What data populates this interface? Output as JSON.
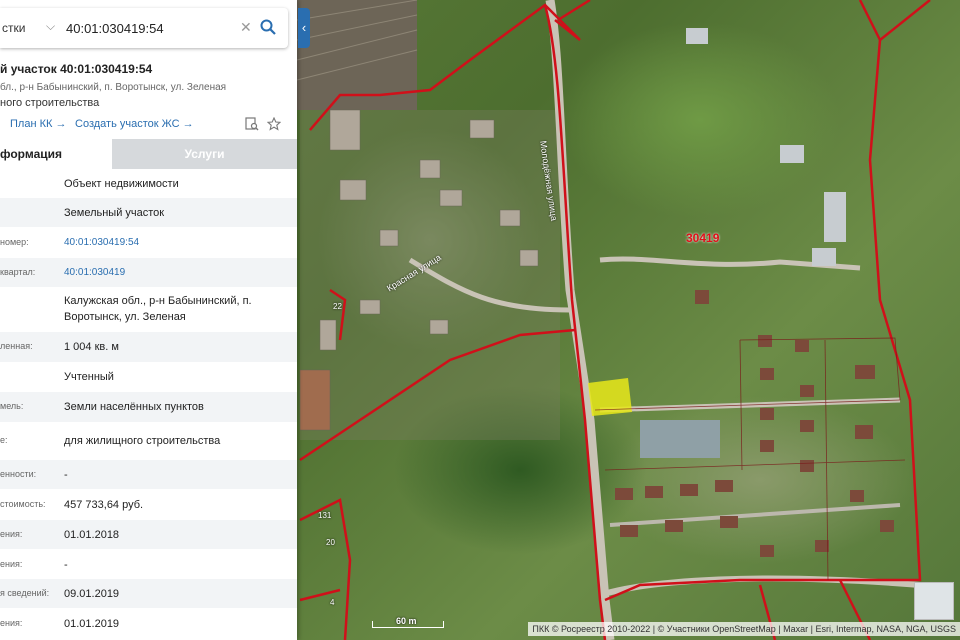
{
  "search": {
    "type_label": "стки",
    "value": "40:01:030419:54"
  },
  "object": {
    "title": "й участок 40:01:030419:54",
    "address_short": "бл., р-н Бабынинский, п. Воротынск, ул. Зеленая",
    "usage_short": "ного строительства"
  },
  "actions": {
    "plan_kk": "План КК →",
    "create_zs": "Создать участок ЖС →"
  },
  "tabs": {
    "info": "формация",
    "services": "Услуги"
  },
  "properties": [
    {
      "label": "",
      "value": "Объект недвижимости",
      "link": false
    },
    {
      "label": "",
      "value": "Земельный участок",
      "link": false
    },
    {
      "label": "номер:",
      "value": "40:01:030419:54",
      "link": true
    },
    {
      "label": "квартал:",
      "value": "40:01:030419",
      "link": true
    },
    {
      "label": "",
      "value": "Калужская обл., р-н Бабынинский, п. Воротынск, ул. Зеленая",
      "link": false
    },
    {
      "label": "ленная:",
      "value": "1 004 кв. м",
      "link": false
    },
    {
      "label": "",
      "value": "Учтенный",
      "link": false
    },
    {
      "label": "мель:",
      "value": "Земли населённых пунктов",
      "link": false
    },
    {
      "label": "е:",
      "value": "для жилищного строительства",
      "link": false
    },
    {
      "label": "енности:",
      "value": "-",
      "link": false
    },
    {
      "label": "стоимость:",
      "value": "457 733,64 руб.",
      "link": false
    },
    {
      "label": "ения:",
      "value": "01.01.2018",
      "link": false
    },
    {
      "label": "ения:",
      "value": "-",
      "link": false
    },
    {
      "label": "я сведений:",
      "value": "09.01.2019",
      "link": false
    },
    {
      "label": "ения:",
      "value": "01.01.2019",
      "link": false
    }
  ],
  "map": {
    "quarter_label": "30419",
    "streets": [
      "Молодёжная улица",
      "Красная улица"
    ],
    "parcel_numbers": [
      "22",
      "131",
      "20",
      "4"
    ],
    "scale_label": "60 m",
    "attribution": "ПКК © Росреестр 2010-2022 | © Участники OpenStreetMap | Maxar | Esri, Intermap, NASA, NGA, USGS",
    "boundary_color": "#d0101a",
    "parcel_color": "#e8e81a"
  },
  "colors": {
    "accent": "#2a6eb0"
  }
}
